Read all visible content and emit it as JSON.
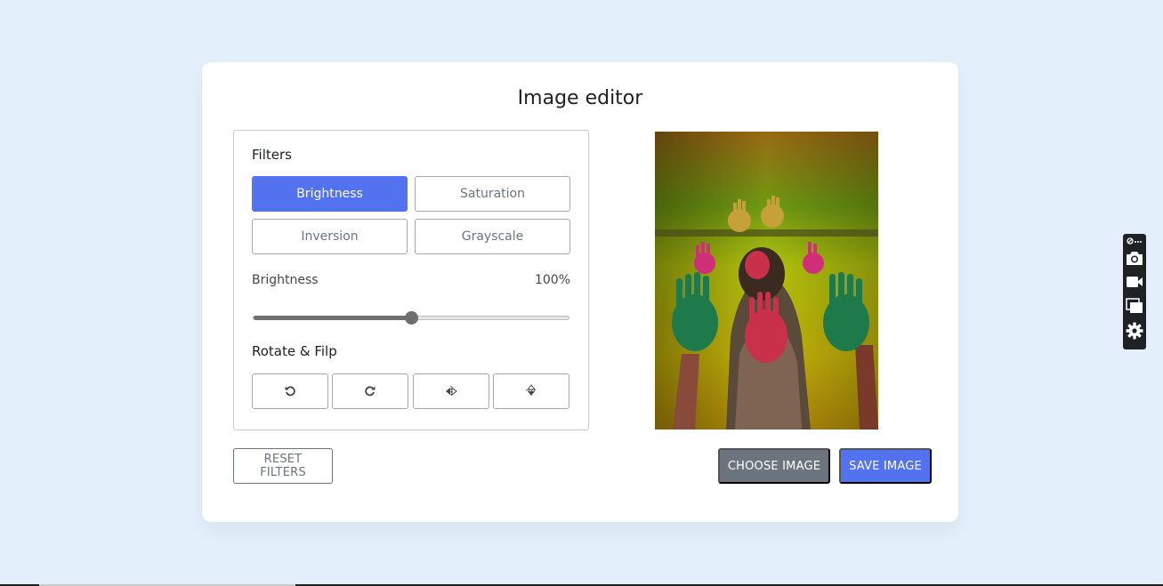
{
  "app": {
    "title": "Image editor"
  },
  "filters": {
    "heading": "Filters",
    "options": [
      "Brightness",
      "Saturation",
      "Inversion",
      "Grayscale"
    ],
    "active": "Brightness"
  },
  "slider": {
    "name": "Brightness",
    "value_label": "100%",
    "value_fraction": 0.5
  },
  "rotate": {
    "heading": "Rotate & Filp",
    "buttons": [
      "rotate-left-icon",
      "rotate-right-icon",
      "flip-horizontal-icon",
      "flip-vertical-icon"
    ]
  },
  "actions": {
    "reset": "RESET FILTERS",
    "choose": "CHOOSE IMAGE",
    "save": "SAVE IMAGE"
  },
  "toolbar": {
    "icons": [
      "screenshot-tool-icon",
      "camera-icon",
      "video-icon",
      "windows-icon",
      "gear-icon"
    ]
  },
  "colors": {
    "accent": "#5372f0",
    "secondary": "#6c757d",
    "background": "#e3f0fc"
  }
}
